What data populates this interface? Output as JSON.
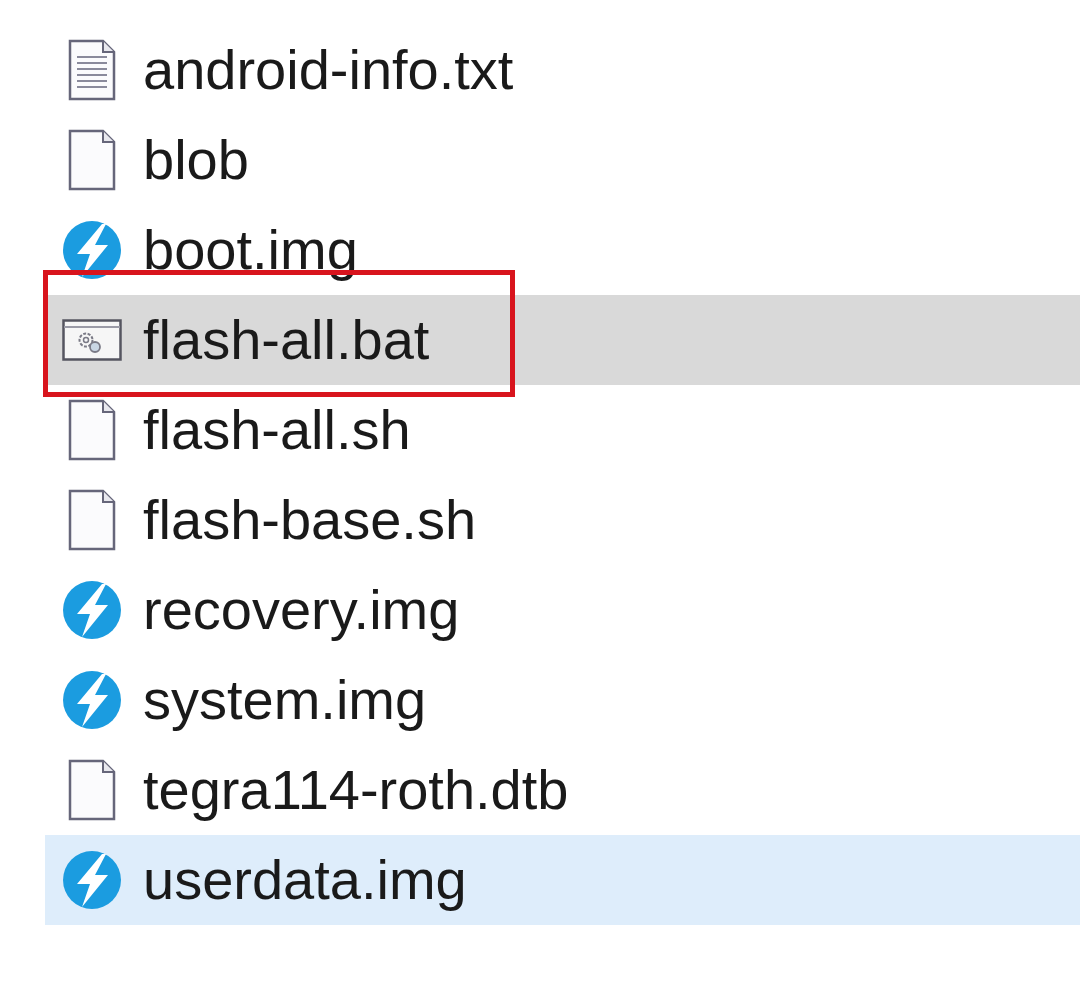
{
  "files": [
    {
      "name": "android-info.txt",
      "kind": "text",
      "selected": false,
      "hovered": false,
      "outlined": false
    },
    {
      "name": "blob",
      "kind": "blank",
      "selected": false,
      "hovered": false,
      "outlined": false
    },
    {
      "name": "boot.img",
      "kind": "image",
      "selected": false,
      "hovered": false,
      "outlined": false
    },
    {
      "name": "flash-all.bat",
      "kind": "batch",
      "selected": true,
      "hovered": false,
      "outlined": true
    },
    {
      "name": "flash-all.sh",
      "kind": "blank",
      "selected": false,
      "hovered": false,
      "outlined": false
    },
    {
      "name": "flash-base.sh",
      "kind": "blank",
      "selected": false,
      "hovered": false,
      "outlined": false
    },
    {
      "name": "recovery.img",
      "kind": "image",
      "selected": false,
      "hovered": false,
      "outlined": false
    },
    {
      "name": "system.img",
      "kind": "image",
      "selected": false,
      "hovered": false,
      "outlined": false
    },
    {
      "name": "tegra114-roth.dtb",
      "kind": "blank",
      "selected": false,
      "hovered": false,
      "outlined": false
    },
    {
      "name": "userdata.img",
      "kind": "image",
      "selected": false,
      "hovered": true,
      "outlined": false
    }
  ]
}
